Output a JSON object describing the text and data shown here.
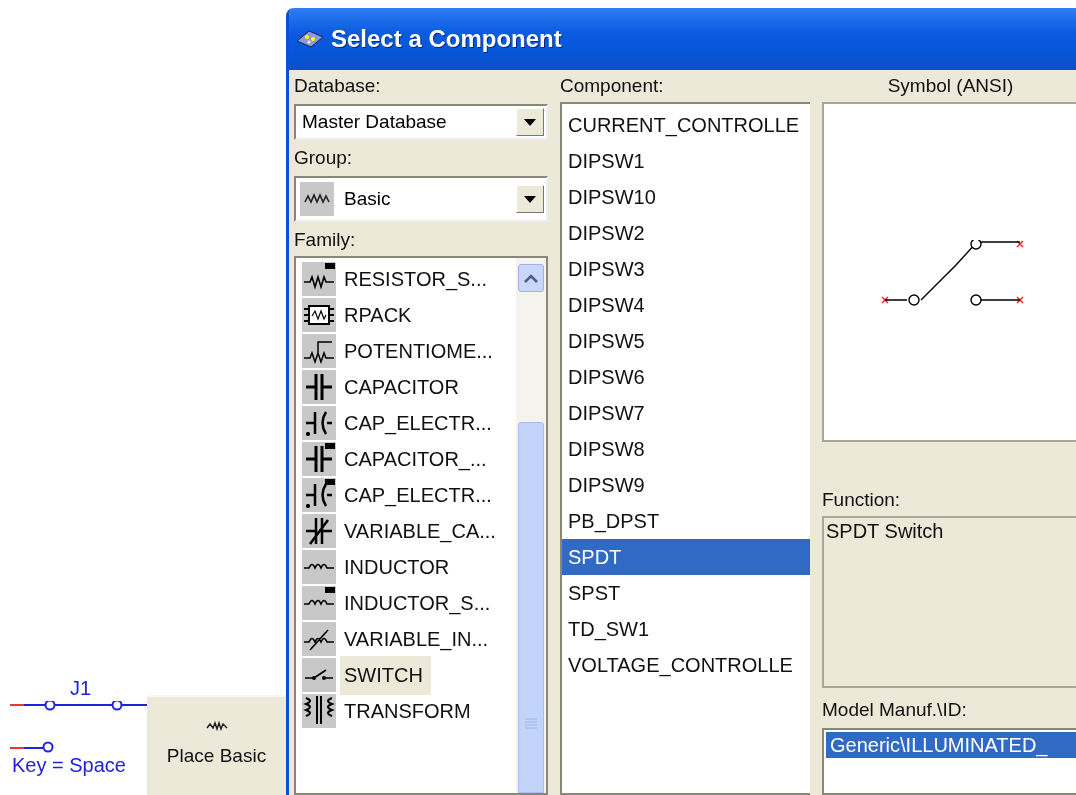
{
  "canvas": {
    "part_label": "J1",
    "key_label": "Key = Space",
    "place_button": {
      "label": "Place Basic"
    }
  },
  "dialog": {
    "title": "Select a Component",
    "database": {
      "label": "Database:",
      "value": "Master Database"
    },
    "group": {
      "label": "Group:",
      "value": "Basic"
    },
    "family": {
      "label": "Family:",
      "items": [
        {
          "label": "RESISTOR_S...",
          "kind": "resistor-smt",
          "selected": false
        },
        {
          "label": "RPACK",
          "kind": "rpack",
          "selected": false
        },
        {
          "label": "POTENTIOME...",
          "kind": "potentiometer",
          "selected": false
        },
        {
          "label": "CAPACITOR",
          "kind": "capacitor",
          "selected": false
        },
        {
          "label": "CAP_ELECTR...",
          "kind": "electrolytic",
          "selected": false
        },
        {
          "label": "CAPACITOR_...",
          "kind": "capacitor-smt",
          "selected": false
        },
        {
          "label": "CAP_ELECTR...",
          "kind": "electrolytic-smt",
          "selected": false
        },
        {
          "label": "VARIABLE_CA...",
          "kind": "variable-capacitor",
          "selected": false
        },
        {
          "label": "INDUCTOR",
          "kind": "inductor",
          "selected": false
        },
        {
          "label": "INDUCTOR_S...",
          "kind": "inductor-smt",
          "selected": false
        },
        {
          "label": "VARIABLE_IN...",
          "kind": "variable-inductor",
          "selected": false
        },
        {
          "label": "SWITCH",
          "kind": "switch",
          "selected": true
        },
        {
          "label": "TRANSFORM",
          "kind": "transformer",
          "selected": false
        }
      ]
    },
    "component": {
      "label": "Component:",
      "items": [
        {
          "label": "CURRENT_CONTROLLE",
          "selected": false
        },
        {
          "label": "DIPSW1",
          "selected": false
        },
        {
          "label": "DIPSW10",
          "selected": false
        },
        {
          "label": "DIPSW2",
          "selected": false
        },
        {
          "label": "DIPSW3",
          "selected": false
        },
        {
          "label": "DIPSW4",
          "selected": false
        },
        {
          "label": "DIPSW5",
          "selected": false
        },
        {
          "label": "DIPSW6",
          "selected": false
        },
        {
          "label": "DIPSW7",
          "selected": false
        },
        {
          "label": "DIPSW8",
          "selected": false
        },
        {
          "label": "DIPSW9",
          "selected": false
        },
        {
          "label": "PB_DPST",
          "selected": false
        },
        {
          "label": "SPDT",
          "selected": true
        },
        {
          "label": "SPST",
          "selected": false
        },
        {
          "label": "TD_SW1",
          "selected": false
        },
        {
          "label": "VOLTAGE_CONTROLLE",
          "selected": false
        }
      ]
    },
    "symbol": {
      "label": "Symbol (ANSI)"
    },
    "function": {
      "label": "Function:",
      "value": "SPDT Switch"
    },
    "model": {
      "label": "Model Manuf.\\ID:",
      "items": [
        {
          "label": "Generic\\ILLUMINATED_",
          "selected": true
        }
      ]
    }
  }
}
